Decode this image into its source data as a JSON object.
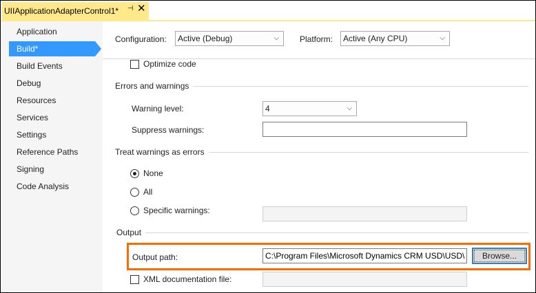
{
  "tab": {
    "title": "UIIApplicationAdapterControl1*",
    "pin_glyph": "⊣",
    "close_glyph": "✕"
  },
  "sidebar": {
    "items": [
      {
        "label": "Application"
      },
      {
        "label": "Build*",
        "active": true
      },
      {
        "label": "Build Events"
      },
      {
        "label": "Debug"
      },
      {
        "label": "Resources"
      },
      {
        "label": "Services"
      },
      {
        "label": "Settings"
      },
      {
        "label": "Reference Paths"
      },
      {
        "label": "Signing"
      },
      {
        "label": "Code Analysis"
      }
    ]
  },
  "header": {
    "configuration_label": "Configuration:",
    "configuration_value": "Active (Debug)",
    "platform_label": "Platform:",
    "platform_value": "Active (Any CPU)"
  },
  "general": {
    "optimize_label": "Optimize code"
  },
  "errors": {
    "title": "Errors and warnings",
    "warning_level_label": "Warning level:",
    "warning_level_value": "4",
    "suppress_label": "Suppress warnings:",
    "suppress_value": ""
  },
  "treat": {
    "title": "Treat warnings as errors",
    "none_label": "None",
    "all_label": "All",
    "specific_label": "Specific warnings:"
  },
  "output": {
    "title": "Output",
    "path_label": "Output path:",
    "path_value": "C:\\Program Files\\Microsoft Dynamics CRM USD\\USD\\",
    "browse_label": "Browse...",
    "xml_label": "XML documentation file:"
  },
  "colors": {
    "accent": "#3399ff",
    "tab": "#ffe98a",
    "highlight": "#ff6a00"
  }
}
